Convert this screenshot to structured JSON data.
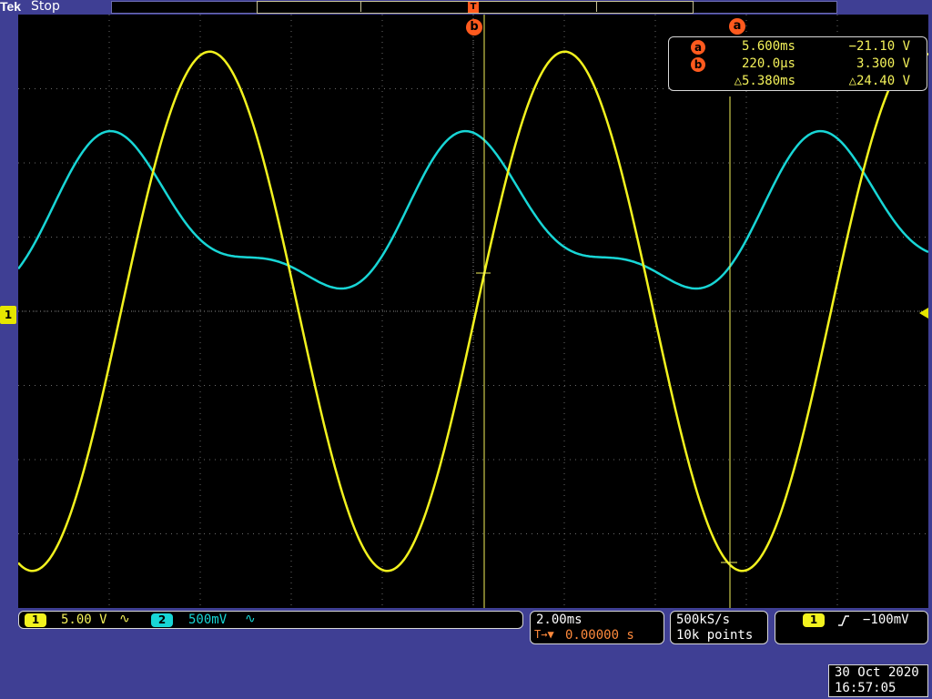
{
  "header": {
    "brand": "Tek",
    "acquisition_state": "Stop",
    "trigger_position_marker": "T"
  },
  "colors": {
    "ch1": "#f2f21e",
    "ch2": "#18d6d6",
    "cursor": "#ff5a1e",
    "readout_text": "#f4f25a",
    "background": "#3f3f94"
  },
  "channel1_marker": "1",
  "cursors": {
    "a_label": "a",
    "b_label": "b",
    "readout": [
      {
        "badge": "a",
        "time": "5.600ms",
        "value": "−21.10 V"
      },
      {
        "badge": "b",
        "time": "220.0µs",
        "value": "3.300 V"
      },
      {
        "badge": "",
        "time": "△5.380ms",
        "value": "△24.40 V"
      }
    ]
  },
  "waveforms": {
    "ch1": {
      "shape": "sine",
      "peak_divisions": 3.5,
      "period_divisions": 3.9
    },
    "ch2": {
      "shape": "distorted-sine",
      "period_divisions": 3.9
    }
  },
  "bottom": {
    "ch1": {
      "badge": "1",
      "scale": "5.00 V",
      "coupling_icon": "∿"
    },
    "ch2": {
      "badge": "2",
      "scale": "500mV",
      "coupling_icon": "∿"
    },
    "timebase": "2.00ms",
    "trigger_position": "0.00000 s",
    "trigger_position_icon": "T→▼",
    "sample_rate": "500kS/s",
    "record_length": "10k points",
    "trigger": {
      "source": "1",
      "slope_icon": "rising-edge-icon",
      "level": "−100mV"
    },
    "date": "30 Oct  2020",
    "time": "16:57:05"
  }
}
